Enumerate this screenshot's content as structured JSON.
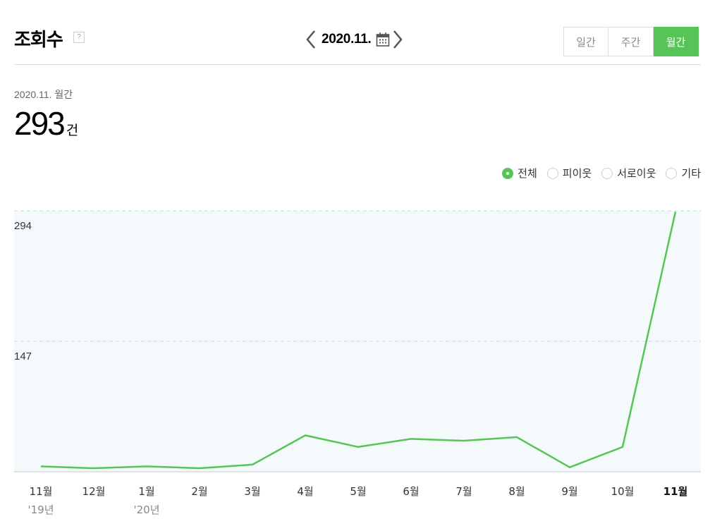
{
  "header": {
    "title": "조회수",
    "help_icon": "question-icon",
    "date_label": "2020.11.",
    "calendar_icon": "calendar-icon",
    "period_tabs": [
      {
        "label": "일간",
        "active": false
      },
      {
        "label": "주간",
        "active": false
      },
      {
        "label": "월간",
        "active": true
      }
    ]
  },
  "summary": {
    "period": "2020.11. 월간",
    "value": "293",
    "unit": "건"
  },
  "filters": [
    {
      "label": "전체",
      "checked": true
    },
    {
      "label": "피이웃",
      "checked": false
    },
    {
      "label": "서로이웃",
      "checked": false
    },
    {
      "label": "기타",
      "checked": false
    }
  ],
  "colors": {
    "accent": "#57c457",
    "plot_bg": "#f4fafc",
    "grid": "#cfe6ee"
  },
  "chart_data": {
    "type": "line",
    "categories": [
      "11월",
      "12월",
      "1월",
      "2월",
      "3월",
      "4월",
      "5월",
      "6월",
      "7월",
      "8월",
      "9월",
      "10월",
      "11월"
    ],
    "year_labels": [
      "'19년",
      "",
      "'20년",
      "",
      "",
      "",
      "",
      "",
      "",
      "",
      "",
      "",
      ""
    ],
    "series": [
      {
        "values": [
          6,
          4,
          6,
          4,
          8,
          41,
          28,
          37,
          35,
          39,
          5,
          28,
          293
        ]
      }
    ],
    "yticks": [
      147,
      294
    ],
    "ylim": [
      0,
      294
    ],
    "highlight_category_index": 12,
    "grid": true
  }
}
